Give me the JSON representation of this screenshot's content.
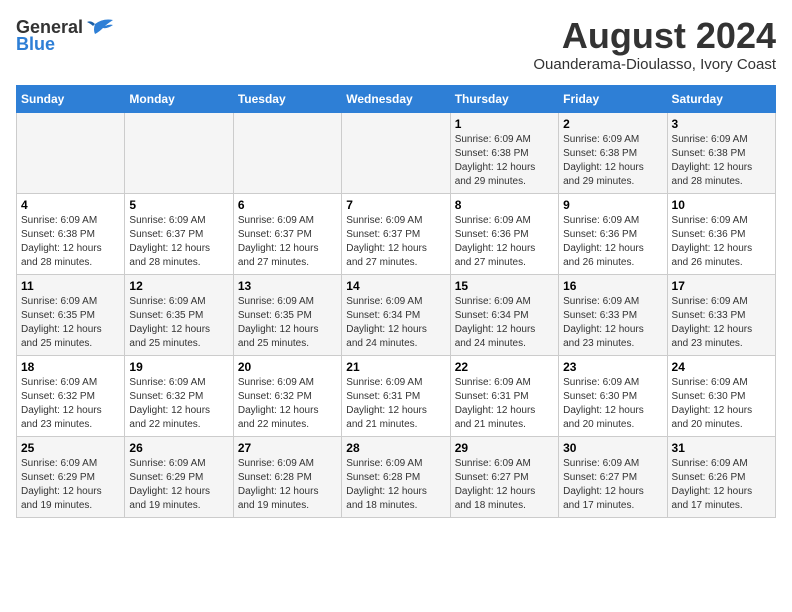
{
  "header": {
    "logo_general": "General",
    "logo_blue": "Blue",
    "month_title": "August 2024",
    "subtitle": "Ouanderama-Dioulasso, Ivory Coast"
  },
  "days_of_week": [
    "Sunday",
    "Monday",
    "Tuesday",
    "Wednesday",
    "Thursday",
    "Friday",
    "Saturday"
  ],
  "weeks": [
    [
      {
        "day": "",
        "sunrise": "",
        "sunset": "",
        "daylight": ""
      },
      {
        "day": "",
        "sunrise": "",
        "sunset": "",
        "daylight": ""
      },
      {
        "day": "",
        "sunrise": "",
        "sunset": "",
        "daylight": ""
      },
      {
        "day": "",
        "sunrise": "",
        "sunset": "",
        "daylight": ""
      },
      {
        "day": "1",
        "sunrise": "Sunrise: 6:09 AM",
        "sunset": "Sunset: 6:38 PM",
        "daylight": "Daylight: 12 hours and 29 minutes."
      },
      {
        "day": "2",
        "sunrise": "Sunrise: 6:09 AM",
        "sunset": "Sunset: 6:38 PM",
        "daylight": "Daylight: 12 hours and 29 minutes."
      },
      {
        "day": "3",
        "sunrise": "Sunrise: 6:09 AM",
        "sunset": "Sunset: 6:38 PM",
        "daylight": "Daylight: 12 hours and 28 minutes."
      }
    ],
    [
      {
        "day": "4",
        "sunrise": "Sunrise: 6:09 AM",
        "sunset": "Sunset: 6:38 PM",
        "daylight": "Daylight: 12 hours and 28 minutes."
      },
      {
        "day": "5",
        "sunrise": "Sunrise: 6:09 AM",
        "sunset": "Sunset: 6:37 PM",
        "daylight": "Daylight: 12 hours and 28 minutes."
      },
      {
        "day": "6",
        "sunrise": "Sunrise: 6:09 AM",
        "sunset": "Sunset: 6:37 PM",
        "daylight": "Daylight: 12 hours and 27 minutes."
      },
      {
        "day": "7",
        "sunrise": "Sunrise: 6:09 AM",
        "sunset": "Sunset: 6:37 PM",
        "daylight": "Daylight: 12 hours and 27 minutes."
      },
      {
        "day": "8",
        "sunrise": "Sunrise: 6:09 AM",
        "sunset": "Sunset: 6:36 PM",
        "daylight": "Daylight: 12 hours and 27 minutes."
      },
      {
        "day": "9",
        "sunrise": "Sunrise: 6:09 AM",
        "sunset": "Sunset: 6:36 PM",
        "daylight": "Daylight: 12 hours and 26 minutes."
      },
      {
        "day": "10",
        "sunrise": "Sunrise: 6:09 AM",
        "sunset": "Sunset: 6:36 PM",
        "daylight": "Daylight: 12 hours and 26 minutes."
      }
    ],
    [
      {
        "day": "11",
        "sunrise": "Sunrise: 6:09 AM",
        "sunset": "Sunset: 6:35 PM",
        "daylight": "Daylight: 12 hours and 25 minutes."
      },
      {
        "day": "12",
        "sunrise": "Sunrise: 6:09 AM",
        "sunset": "Sunset: 6:35 PM",
        "daylight": "Daylight: 12 hours and 25 minutes."
      },
      {
        "day": "13",
        "sunrise": "Sunrise: 6:09 AM",
        "sunset": "Sunset: 6:35 PM",
        "daylight": "Daylight: 12 hours and 25 minutes."
      },
      {
        "day": "14",
        "sunrise": "Sunrise: 6:09 AM",
        "sunset": "Sunset: 6:34 PM",
        "daylight": "Daylight: 12 hours and 24 minutes."
      },
      {
        "day": "15",
        "sunrise": "Sunrise: 6:09 AM",
        "sunset": "Sunset: 6:34 PM",
        "daylight": "Daylight: 12 hours and 24 minutes."
      },
      {
        "day": "16",
        "sunrise": "Sunrise: 6:09 AM",
        "sunset": "Sunset: 6:33 PM",
        "daylight": "Daylight: 12 hours and 23 minutes."
      },
      {
        "day": "17",
        "sunrise": "Sunrise: 6:09 AM",
        "sunset": "Sunset: 6:33 PM",
        "daylight": "Daylight: 12 hours and 23 minutes."
      }
    ],
    [
      {
        "day": "18",
        "sunrise": "Sunrise: 6:09 AM",
        "sunset": "Sunset: 6:32 PM",
        "daylight": "Daylight: 12 hours and 23 minutes."
      },
      {
        "day": "19",
        "sunrise": "Sunrise: 6:09 AM",
        "sunset": "Sunset: 6:32 PM",
        "daylight": "Daylight: 12 hours and 22 minutes."
      },
      {
        "day": "20",
        "sunrise": "Sunrise: 6:09 AM",
        "sunset": "Sunset: 6:32 PM",
        "daylight": "Daylight: 12 hours and 22 minutes."
      },
      {
        "day": "21",
        "sunrise": "Sunrise: 6:09 AM",
        "sunset": "Sunset: 6:31 PM",
        "daylight": "Daylight: 12 hours and 21 minutes."
      },
      {
        "day": "22",
        "sunrise": "Sunrise: 6:09 AM",
        "sunset": "Sunset: 6:31 PM",
        "daylight": "Daylight: 12 hours and 21 minutes."
      },
      {
        "day": "23",
        "sunrise": "Sunrise: 6:09 AM",
        "sunset": "Sunset: 6:30 PM",
        "daylight": "Daylight: 12 hours and 20 minutes."
      },
      {
        "day": "24",
        "sunrise": "Sunrise: 6:09 AM",
        "sunset": "Sunset: 6:30 PM",
        "daylight": "Daylight: 12 hours and 20 minutes."
      }
    ],
    [
      {
        "day": "25",
        "sunrise": "Sunrise: 6:09 AM",
        "sunset": "Sunset: 6:29 PM",
        "daylight": "Daylight: 12 hours and 19 minutes."
      },
      {
        "day": "26",
        "sunrise": "Sunrise: 6:09 AM",
        "sunset": "Sunset: 6:29 PM",
        "daylight": "Daylight: 12 hours and 19 minutes."
      },
      {
        "day": "27",
        "sunrise": "Sunrise: 6:09 AM",
        "sunset": "Sunset: 6:28 PM",
        "daylight": "Daylight: 12 hours and 19 minutes."
      },
      {
        "day": "28",
        "sunrise": "Sunrise: 6:09 AM",
        "sunset": "Sunset: 6:28 PM",
        "daylight": "Daylight: 12 hours and 18 minutes."
      },
      {
        "day": "29",
        "sunrise": "Sunrise: 6:09 AM",
        "sunset": "Sunset: 6:27 PM",
        "daylight": "Daylight: 12 hours and 18 minutes."
      },
      {
        "day": "30",
        "sunrise": "Sunrise: 6:09 AM",
        "sunset": "Sunset: 6:27 PM",
        "daylight": "Daylight: 12 hours and 17 minutes."
      },
      {
        "day": "31",
        "sunrise": "Sunrise: 6:09 AM",
        "sunset": "Sunset: 6:26 PM",
        "daylight": "Daylight: 12 hours and 17 minutes."
      }
    ]
  ]
}
